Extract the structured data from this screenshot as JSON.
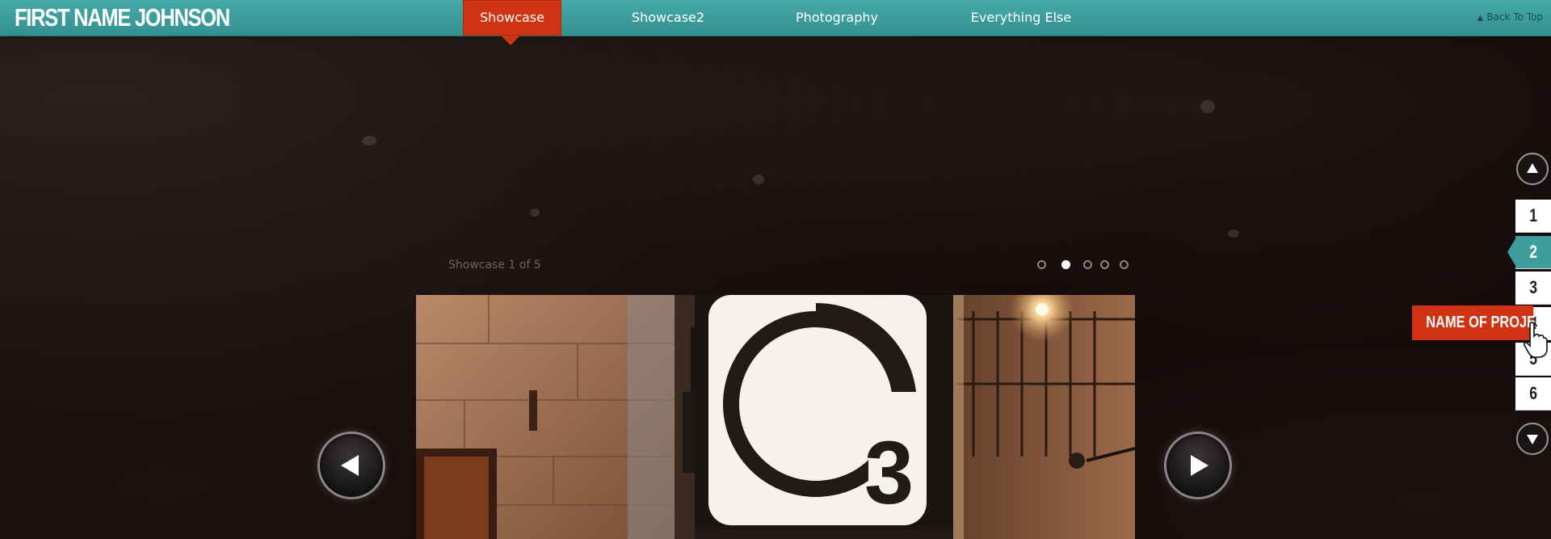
{
  "header": {
    "logo": "FIRST NAME JOHNSON",
    "nav": [
      {
        "label": "Showcase",
        "active": true
      },
      {
        "label": "Showcase2",
        "active": false
      },
      {
        "label": "Photography",
        "active": false
      },
      {
        "label": "Everything Else",
        "active": false
      }
    ],
    "back_to_top": "Back To Top"
  },
  "showcase": {
    "counter": "Showcase 1 of 5",
    "dots_total": 5,
    "dots_active_index": 1,
    "image_sign_text": "3"
  },
  "pager": {
    "up_icon": "arrow-up-icon",
    "down_icon": "arrow-down-icon",
    "pages": [
      "1",
      "2",
      "3",
      "4",
      "5",
      "6"
    ],
    "active_page": "2",
    "hover_tooltip": "NAME OF PROJECT"
  },
  "colors": {
    "teal": "#3f9e9d",
    "accent_red": "#cf3312",
    "background": "#120708"
  }
}
